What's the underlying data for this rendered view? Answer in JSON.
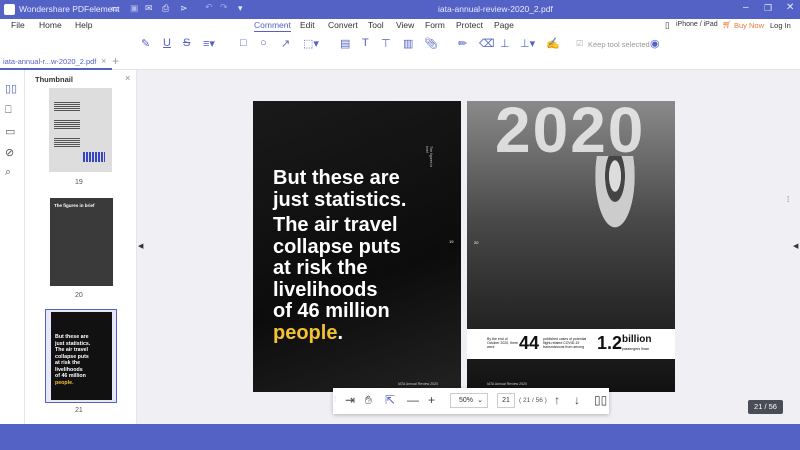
{
  "app": {
    "title": "Wondershare PDFelement",
    "doc_title": "iata-annual-review-2020_2.pdf"
  },
  "menu": {
    "left": [
      "File",
      "Home",
      "Help"
    ],
    "tabs": [
      "Comment",
      "Edit",
      "Convert",
      "Tool",
      "View",
      "Form",
      "Protect",
      "Page"
    ],
    "active": "Comment",
    "iphone": "iPhone / iPad",
    "buy": "Buy Now",
    "login": "Log In"
  },
  "toolbar": {
    "keep_tool": "Keep tool selected"
  },
  "tab": {
    "label": "iata-annual-r...w-2020_2.pdf"
  },
  "thumbnail": {
    "title": "Thumbnail",
    "pages": [
      "19",
      "20",
      "21"
    ],
    "p20_title": "The figures in brief",
    "p21_text": [
      "But these are",
      "just statistics.",
      "The air travel",
      "collapse puts",
      "at risk the",
      "livelihoods",
      "of 46 million",
      "people."
    ]
  },
  "page_left": {
    "lines": [
      "But these are",
      "just statistics."
    ],
    "lines2": [
      "The air travel",
      "collapse puts",
      "at risk the",
      "livelihoods",
      "of 46 million"
    ],
    "highlight": "people",
    "period": ".",
    "page_no": "19",
    "footer": "IATA Annual Review 2020",
    "side": "The figures in brief"
  },
  "page_right": {
    "year": "2020",
    "page_no": "20",
    "stat1_pre": "By the end of October 2020, there were",
    "stat1_num": "44",
    "stat1_post": "published cases of potential flight-related COVID-19 transmissions from among",
    "stat2_num": "1.2",
    "stat2_unit": "billion",
    "stat2_post": "passengers flown",
    "footer": "IATA Annual Review 2020"
  },
  "nav": {
    "zoom": "50%",
    "page_input": "21",
    "page_total": "( 21 / 56 )",
    "badge": "21 / 56"
  },
  "colors": {
    "accent": "#5462c6",
    "highlight": "#f2c230",
    "buy": "#f07a3a"
  }
}
